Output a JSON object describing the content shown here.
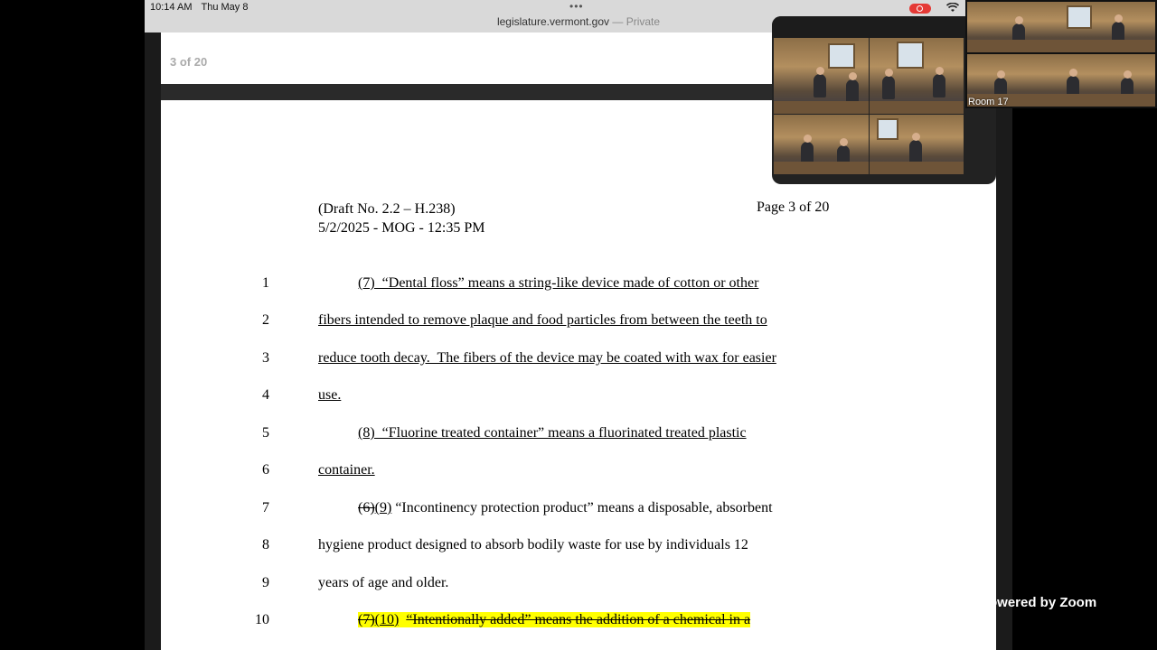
{
  "status_bar": {
    "time": "10:14 AM",
    "date": "Thu May 8",
    "dots": "•••",
    "url": "legislature.vermont.gov",
    "private_label": "— Private"
  },
  "pdf_viewer": {
    "page_indicator": "3 of 20"
  },
  "document": {
    "header_draft": "(Draft No. 2.2 – H.238)",
    "header_date": "5/2/2025 - MOG - 12:35 PM",
    "header_page": "Page 3 of 20",
    "lines": [
      {
        "num": "1",
        "parts": [
          {
            "t": "(7)  “Dental floss” means a string-like device made of cotton or other",
            "style": "u"
          }
        ]
      },
      {
        "num": "2",
        "parts": [
          {
            "t": "fibers intended to remove plaque and food particles from between the teeth to",
            "style": "u"
          }
        ]
      },
      {
        "num": "3",
        "parts": [
          {
            "t": "reduce tooth decay.  The fibers of the device may be coated with wax for easier",
            "style": "u"
          }
        ]
      },
      {
        "num": "4",
        "parts": [
          {
            "t": "use.",
            "style": "u"
          }
        ]
      },
      {
        "num": "5",
        "parts": [
          {
            "t": "(8)  “Fluorine treated container” means a fluorinated treated plastic",
            "style": "u"
          }
        ]
      },
      {
        "num": "6",
        "parts": [
          {
            "t": "container.",
            "style": "u"
          }
        ]
      },
      {
        "num": "7",
        "parts": [
          {
            "t": "(6)",
            "style": "s"
          },
          {
            "t": "(9)",
            "style": "u"
          },
          {
            "t": " “Incontinency protection product” means a disposable, absorbent",
            "style": ""
          }
        ]
      },
      {
        "num": "8",
        "parts": [
          {
            "t": "hygiene product designed to absorb bodily waste for use by individuals 12",
            "style": ""
          }
        ]
      },
      {
        "num": "9",
        "parts": [
          {
            "t": "years of age and older.",
            "style": ""
          }
        ]
      },
      {
        "num": "10",
        "parts": [
          {
            "t": "(7)",
            "style": "s hl"
          },
          {
            "t": "(10)",
            "style": "u hl"
          },
          {
            "t": "  ",
            "style": "hl"
          },
          {
            "t": "“Intentionally added” means the addition of a chemical in a",
            "style": "s hl"
          }
        ]
      }
    ]
  },
  "zoom": {
    "room_label": "Room 17",
    "powered_by": "Powered by Zoom"
  },
  "colors": {
    "highlight": "#ffff00",
    "record": "#e53935"
  }
}
